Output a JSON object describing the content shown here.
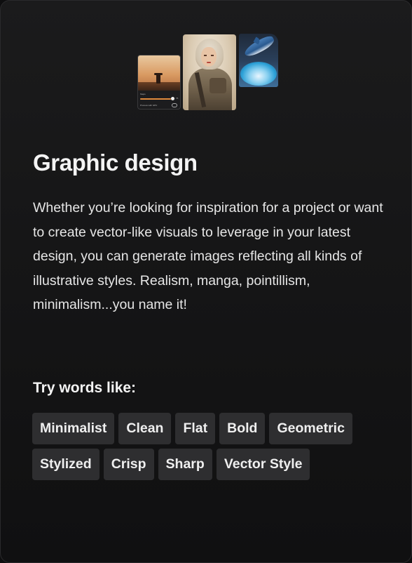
{
  "card": {
    "title": "Graphic design",
    "description": "Whether you’re looking for inspiration for a project or want to create vector-like visuals to leverage in your latest design, you can generate images reflecting all kinds of illustrative styles. Realism, manga, pointillism, minimalism...you name it!",
    "try_heading": "Try words like:",
    "tags": [
      "Minimalist",
      "Clean",
      "Flat",
      "Bold",
      "Geometric",
      "Stylized",
      "Crisp",
      "Sharp",
      "Vector Style"
    ],
    "illustration": {
      "thumbnails": [
        "desert-figure-image",
        "warrior-woman-image",
        "dolphin-splash-image"
      ],
      "mini_panel": {
        "label": "Steps",
        "value": "75",
        "toggle_label": "Process with GPU"
      }
    }
  },
  "colors": {
    "background": "#141415",
    "tag_background": "#2e2e30",
    "text": "#f4f4f4"
  }
}
